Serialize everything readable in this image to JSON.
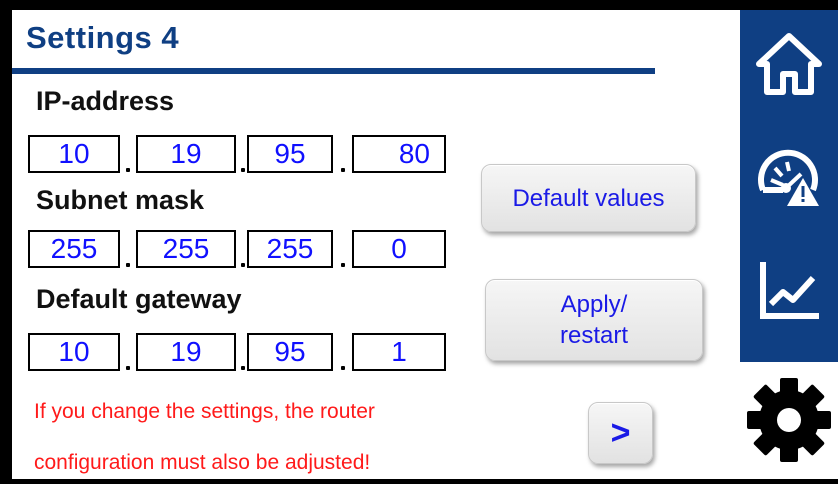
{
  "header": {
    "title": "Settings 4"
  },
  "ip_address": {
    "label": "IP-address",
    "octets": [
      "10",
      "19",
      "95",
      "80"
    ]
  },
  "subnet_mask": {
    "label": "Subnet mask",
    "octets": [
      "255",
      "255",
      "255",
      "0"
    ]
  },
  "default_gateway": {
    "label": "Default gateway",
    "octets": [
      "10",
      "19",
      "95",
      "1"
    ]
  },
  "buttons": {
    "default_values": "Default values",
    "apply_restart": "Apply/\nrestart",
    "next": ">"
  },
  "warning": {
    "line1": "If you change the settings, the router",
    "line2": "configuration must also be adjusted!"
  },
  "sidebar": {
    "items": [
      {
        "icon": "home-icon",
        "active": false
      },
      {
        "icon": "gauge-warning-icon",
        "active": false
      },
      {
        "icon": "line-chart-icon",
        "active": false
      },
      {
        "icon": "gear-icon",
        "active": true
      }
    ]
  },
  "colors": {
    "brand_blue": "#0f3f83",
    "value_blue": "#1010ff",
    "warning_red": "#ff1a1a"
  }
}
